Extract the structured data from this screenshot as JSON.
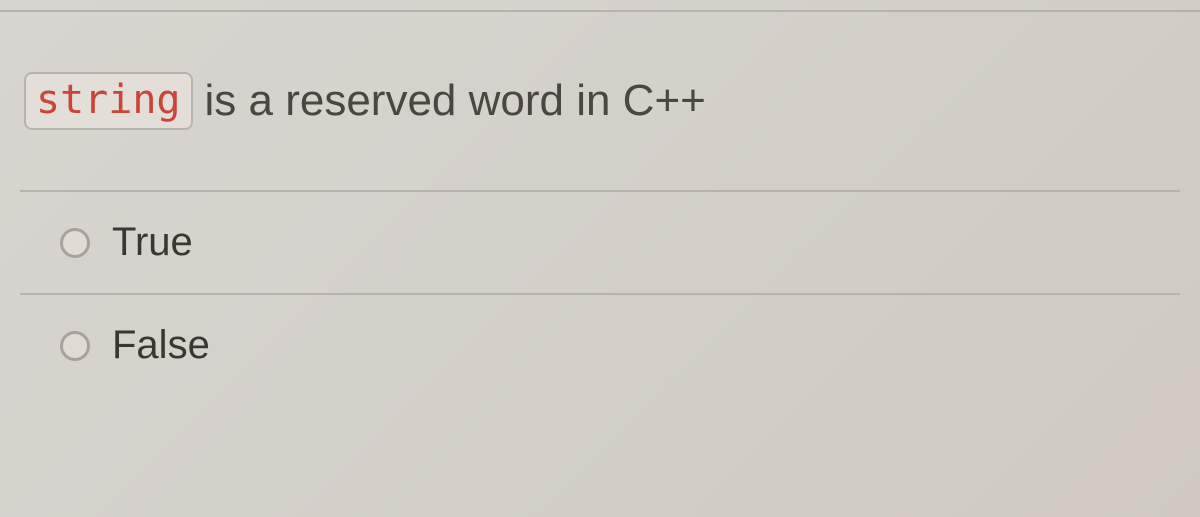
{
  "question": {
    "code_token": "string",
    "text_after": "is a reserved word in C++"
  },
  "options": [
    {
      "label": "True"
    },
    {
      "label": "False"
    }
  ]
}
